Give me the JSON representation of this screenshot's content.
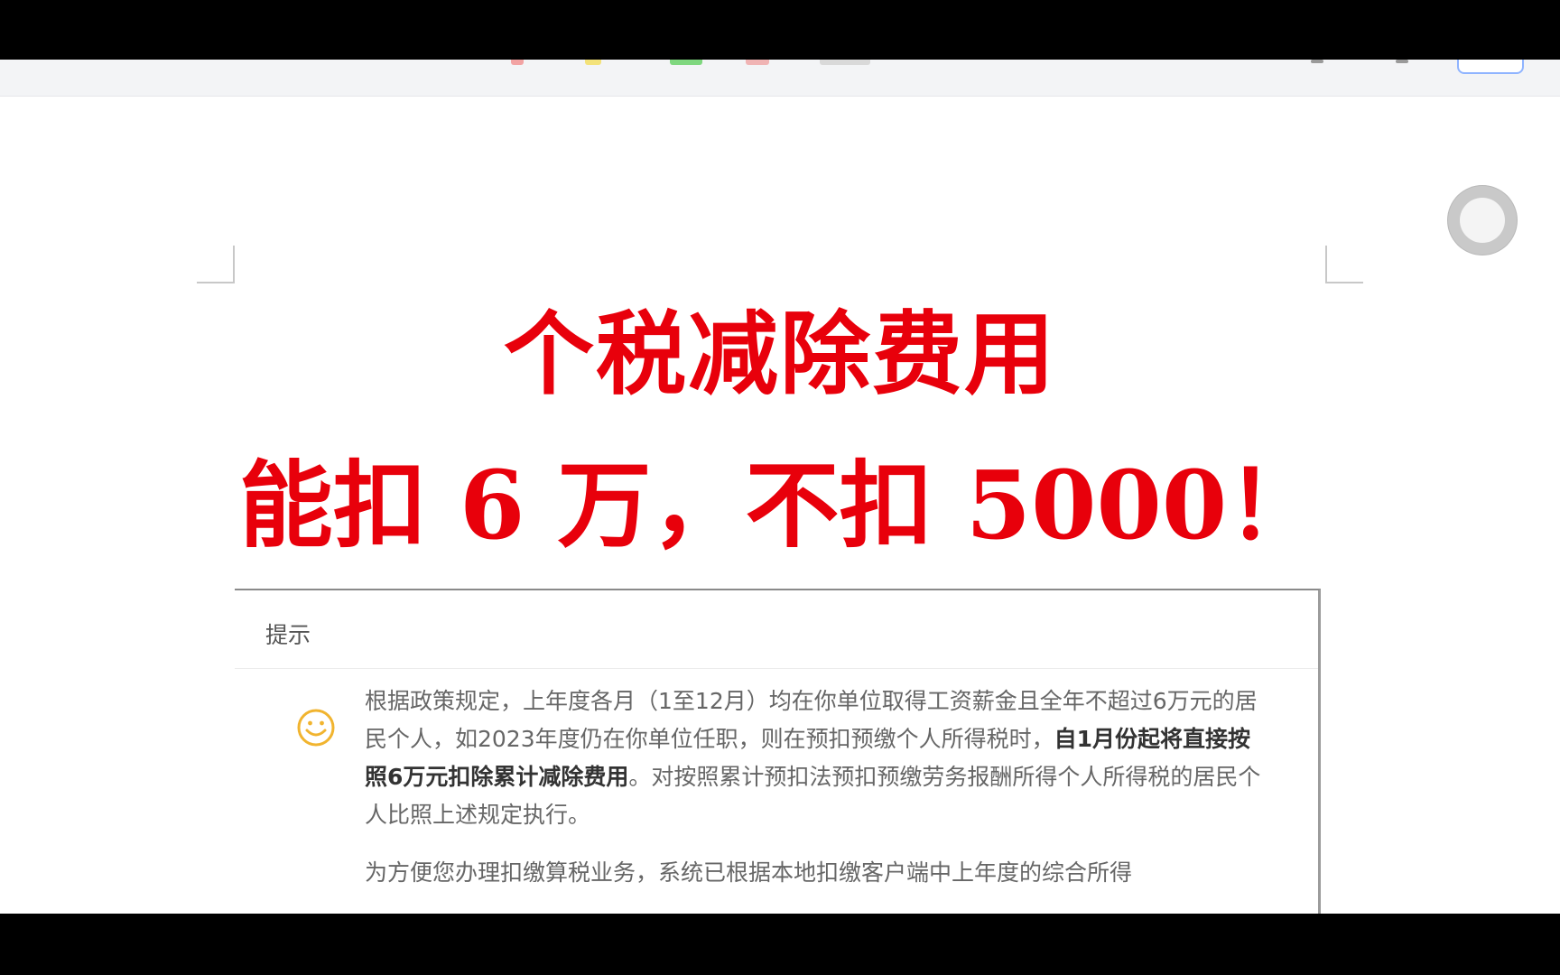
{
  "headline": {
    "line1": "个税减除费用",
    "line2": "能扣 6 万，不扣 5000！",
    "color": "#e8000b"
  },
  "dialog": {
    "title": "提示",
    "icon": "smile-icon",
    "paragraph1": {
      "before_bold": "根据政策规定，上年度各月（1至12月）均在你单位取得工资薪金且全年不超过6万元的居民个人，如2023年度仍在你单位任职，则在预扣预缴个人所得税时，",
      "bold": "自1月份起将直接按照6万元扣除累计减除费用",
      "after_bold": "。对按照累计预扣法预扣预缴劳务报酬所得个人所得税的居民个人比照上述规定执行。"
    },
    "paragraph2": "为方便您办理扣缴算税业务，系统已根据本地扣缴客户端中上年度的综合所得"
  }
}
